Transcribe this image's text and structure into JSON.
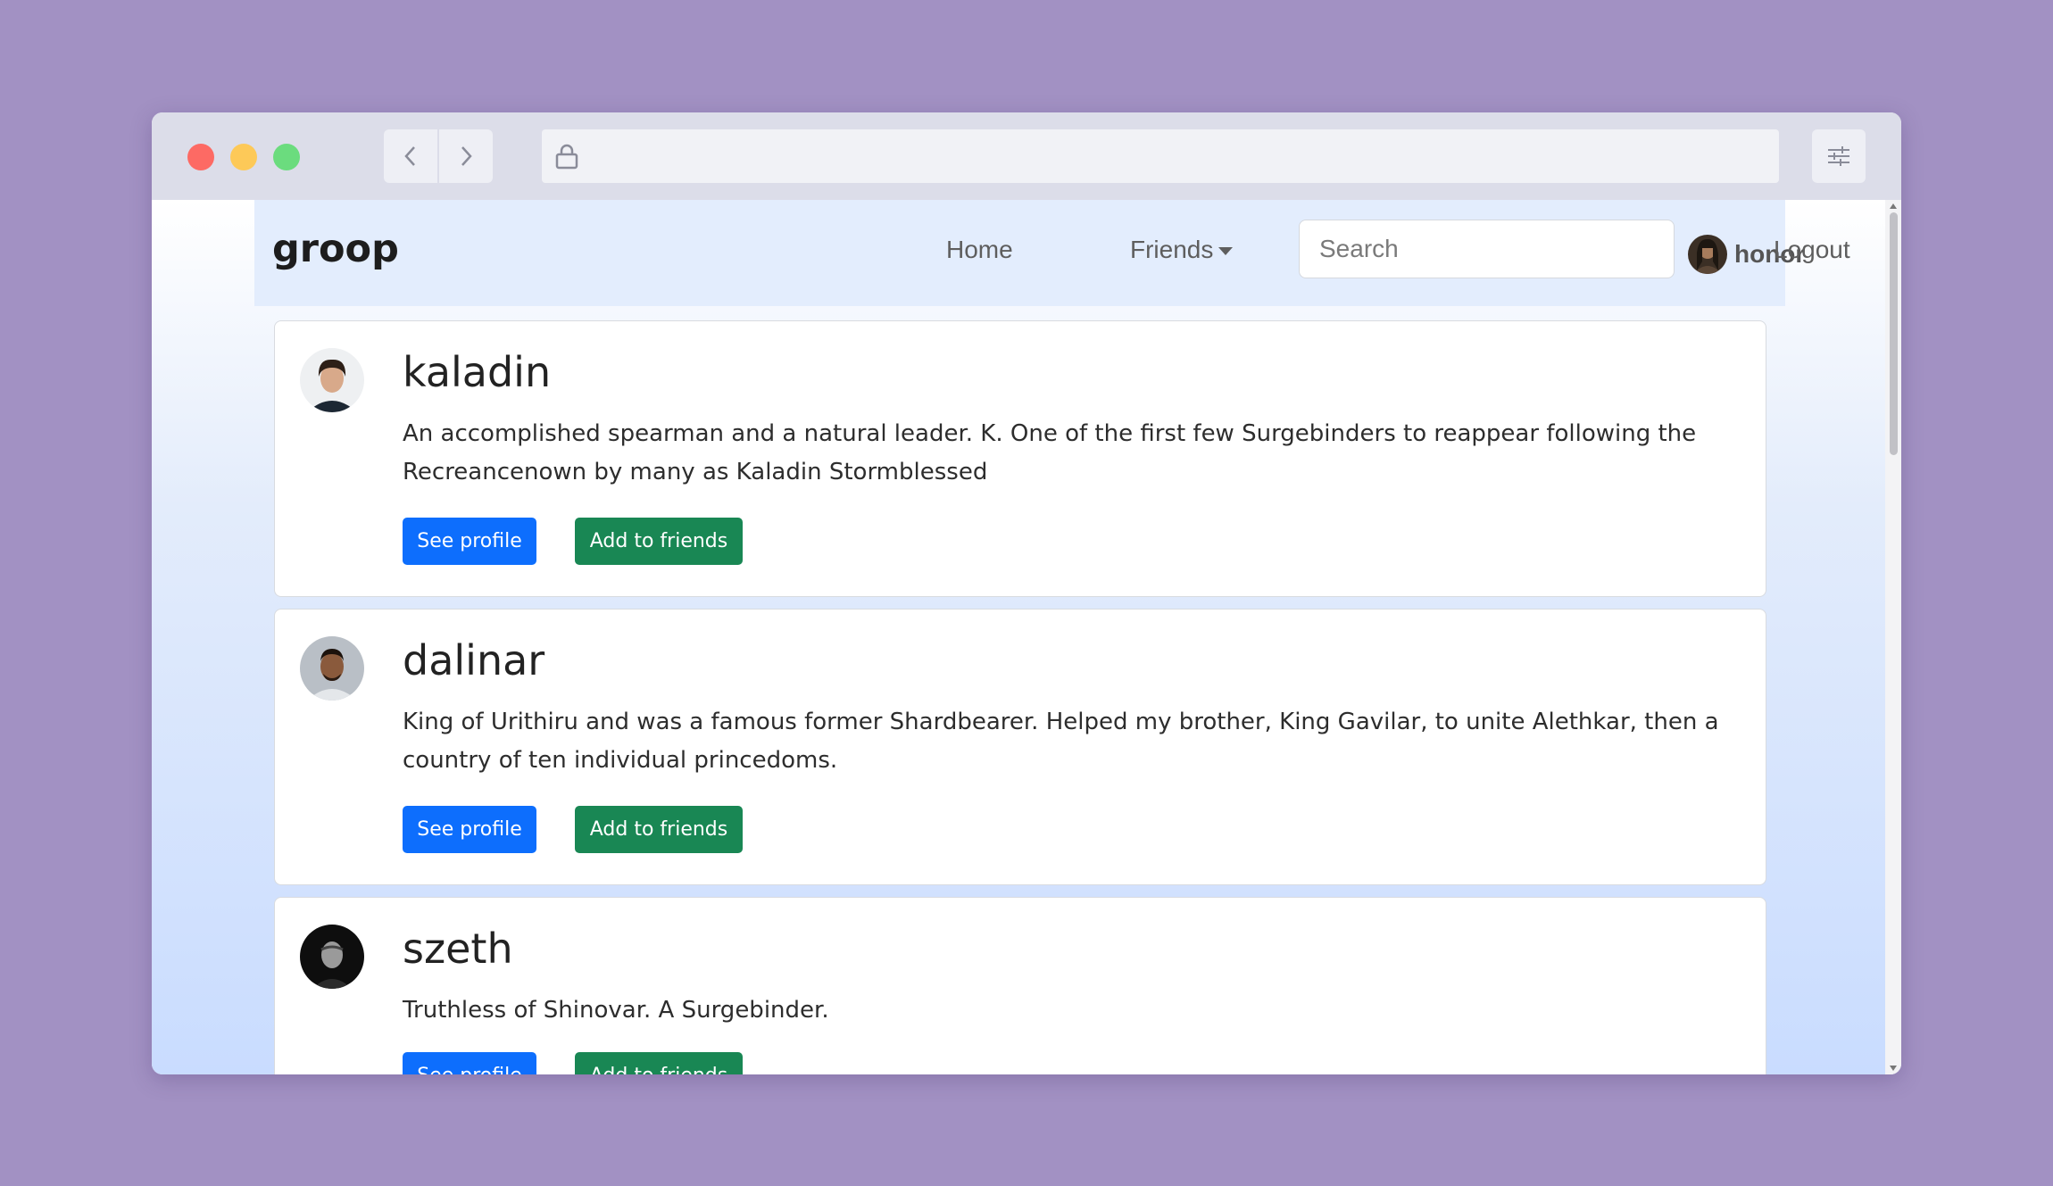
{
  "browser": {
    "url": ""
  },
  "navbar": {
    "brand": "groop",
    "home": "Home",
    "friends": "Friends",
    "search_placeholder": "Search",
    "user_name": "honor",
    "logout": "Logout"
  },
  "users": [
    {
      "name": "kaladin",
      "bio": "An accomplished spearman and a natural leader. K. One of the first few Surgebinders to reappear following the Recreancenown by many as Kaladin Stormblessed",
      "see_profile": "See profile",
      "add_friend": "Add to friends"
    },
    {
      "name": "dalinar",
      "bio": "King of Urithiru and was a famous former Shardbearer. Helped my brother, King Gavilar, to unite Alethkar, then a country of ten individual princedoms.",
      "see_profile": "See profile",
      "add_friend": "Add to friends"
    },
    {
      "name": "szeth",
      "bio": "Truthless of Shinovar. A Surgebinder.",
      "see_profile": "See profile",
      "add_friend": "Add to friends"
    }
  ]
}
